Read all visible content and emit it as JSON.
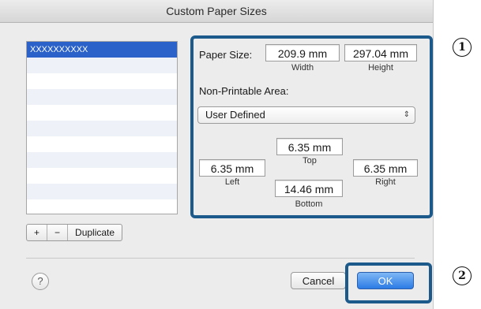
{
  "window": {
    "title": "Custom Paper Sizes"
  },
  "list": {
    "items": [
      "XXXXXXXXXX",
      "",
      "",
      "",
      "",
      "",
      "",
      "",
      "",
      "",
      ""
    ],
    "selected_index": 0
  },
  "list_buttons": {
    "add": "+",
    "remove": "−",
    "duplicate": "Duplicate"
  },
  "paper_size": {
    "label": "Paper Size:",
    "width_value": "209.9 mm",
    "width_label": "Width",
    "height_value": "297.04 mm",
    "height_label": "Height"
  },
  "non_printable": {
    "label": "Non-Printable Area:",
    "selected": "User Defined",
    "top_value": "6.35 mm",
    "top_label": "Top",
    "left_value": "6.35 mm",
    "left_label": "Left",
    "right_value": "6.35 mm",
    "right_label": "Right",
    "bottom_value": "14.46 mm",
    "bottom_label": "Bottom"
  },
  "footer": {
    "help": "?",
    "cancel": "Cancel",
    "ok": "OK"
  },
  "callouts": {
    "one": "1",
    "two": "2"
  },
  "colors": {
    "highlight_frame": "#1c5a8c",
    "selection": "#2a62c9",
    "default_button": "#2c7be5"
  }
}
